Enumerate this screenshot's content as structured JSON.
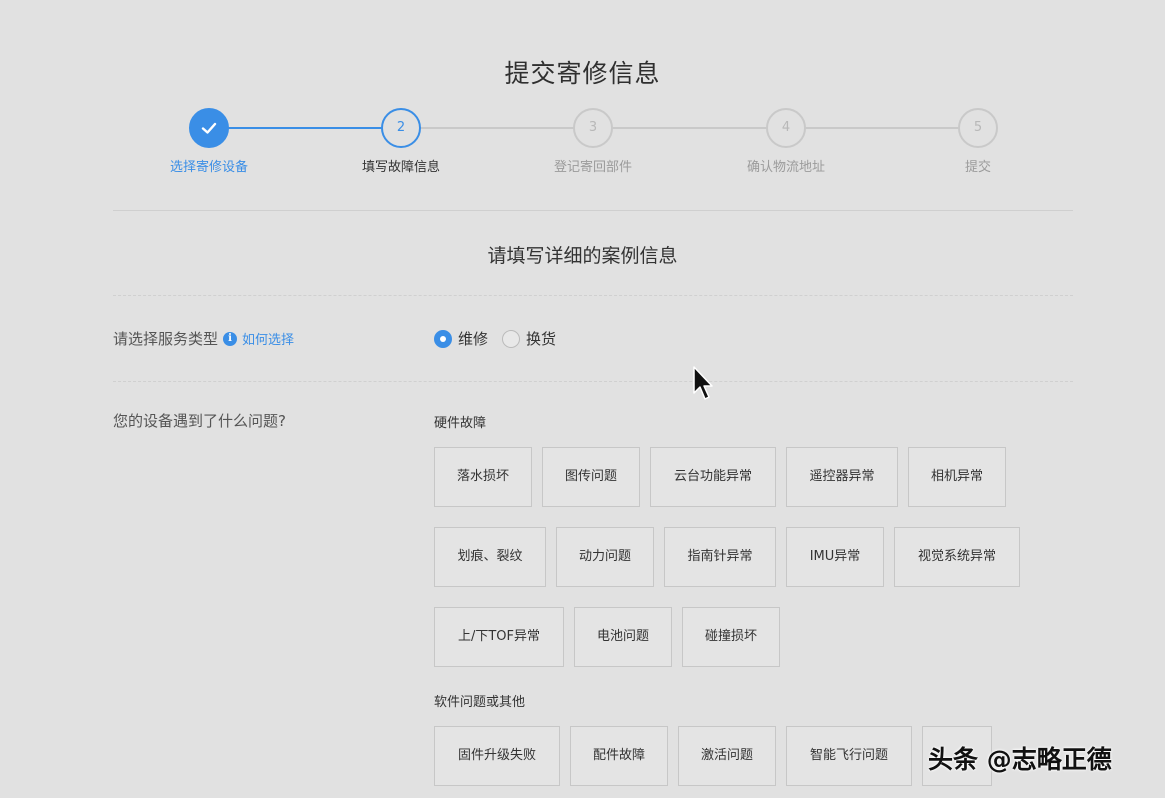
{
  "page_title": "提交寄修信息",
  "steps": [
    {
      "number": "1",
      "label": "选择寄修设备",
      "status": "complete"
    },
    {
      "number": "2",
      "label": "填写故障信息",
      "status": "active"
    },
    {
      "number": "3",
      "label": "登记寄回部件",
      "status": "pending"
    },
    {
      "number": "4",
      "label": "确认物流地址",
      "status": "pending"
    },
    {
      "number": "5",
      "label": "提交",
      "status": "pending"
    }
  ],
  "section_title": "请填写详细的案例信息",
  "service_type": {
    "label": "请选择服务类型",
    "help_link": "如何选择",
    "options": [
      {
        "label": "维修",
        "checked": true
      },
      {
        "label": "换货",
        "checked": false
      }
    ]
  },
  "problem": {
    "label": "您的设备遇到了什么问题?",
    "hardware_heading": "硬件故障",
    "hardware_rows": [
      [
        "落水损坏",
        "图传问题",
        "云台功能异常",
        "遥控器异常",
        "相机异常"
      ],
      [
        "划痕、裂纹",
        "动力问题",
        "指南针异常",
        "IMU异常",
        "视觉系统异常"
      ],
      [
        "上/下TOF异常",
        "电池问题",
        "碰撞损坏"
      ]
    ],
    "software_heading": "软件问题或其他",
    "software_rows": [
      [
        "固件升级失败",
        "配件故障",
        "激活问题",
        "智能飞行问题",
        ""
      ]
    ]
  },
  "watermark": "头条 @志略正德",
  "colors": {
    "accent": "#3a8ee6",
    "background": "#e1e1e1"
  }
}
